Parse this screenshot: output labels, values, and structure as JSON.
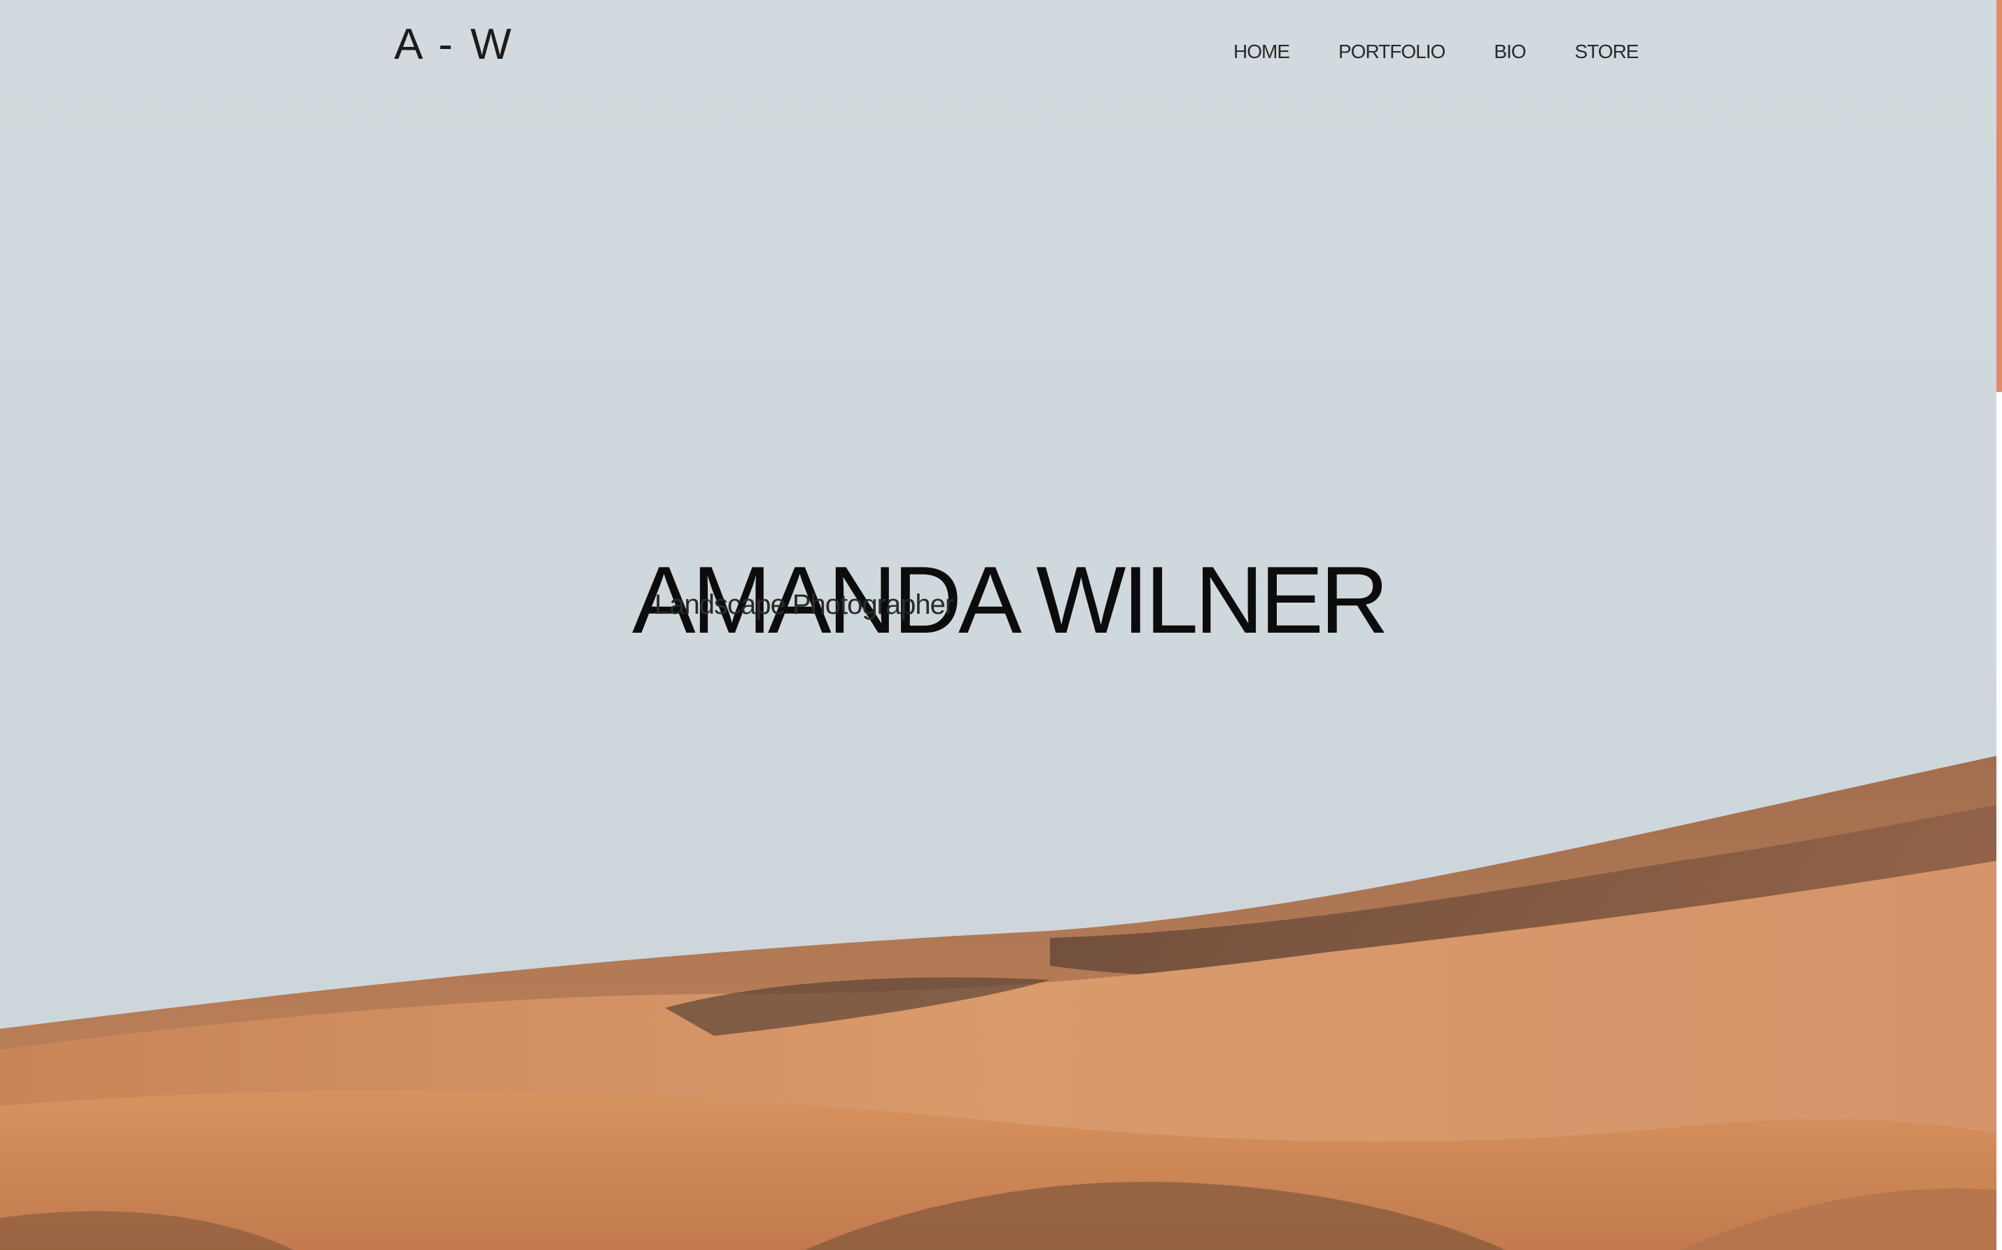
{
  "header": {
    "logo_text": "A - W",
    "nav": [
      {
        "label": "HOME"
      },
      {
        "label": "PORTFOLIO"
      },
      {
        "label": "BIO"
      },
      {
        "label": "STORE"
      }
    ]
  },
  "hero": {
    "title": "AMANDA WILNER",
    "subtitle": "Landscape Photographer",
    "background": "desert-dunes-photo"
  },
  "colors": {
    "sky": "#d1d9de",
    "sand_light": "#d89a6c",
    "sand_mid": "#c47e52",
    "sand_shadow": "#6e4a35",
    "scroll_accent": "#e08a68",
    "text_dark": "#0c0c0c"
  }
}
